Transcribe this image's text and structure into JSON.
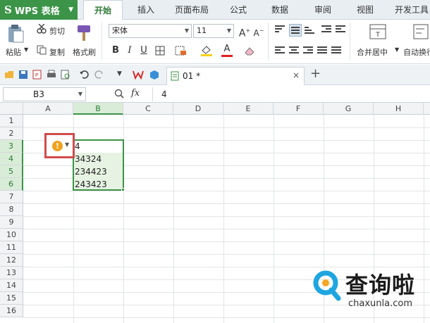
{
  "app": {
    "brand": "WPS 表格",
    "tabs": [
      {
        "label": "开始",
        "active": true
      },
      {
        "label": "插入",
        "active": false
      },
      {
        "label": "页面布局",
        "active": false
      },
      {
        "label": "公式",
        "active": false
      },
      {
        "label": "数据",
        "active": false
      },
      {
        "label": "审阅",
        "active": false
      },
      {
        "label": "视图",
        "active": false
      },
      {
        "label": "开发工具",
        "active": false
      }
    ]
  },
  "ribbon": {
    "paste_label": "粘贴",
    "cut_label": "剪切",
    "copy_label": "复制",
    "format_painter_label": "格式刷",
    "font_name": "宋体",
    "font_size": "11",
    "merge_label": "合并居中",
    "wrap_label": "自动换行"
  },
  "document": {
    "tab_name": "01 *",
    "close_glyph": "×",
    "new_tab_glyph": "+"
  },
  "formula_bar": {
    "name_box": "B3",
    "fx_label": "fx",
    "value": "4"
  },
  "grid": {
    "columns": [
      "A",
      "B",
      "C",
      "D",
      "E",
      "F",
      "G",
      "H"
    ],
    "selected_column": "B",
    "rows": [
      "1",
      "2",
      "3",
      "4",
      "5",
      "6",
      "7",
      "8",
      "9",
      "10",
      "11",
      "12",
      "13",
      "14",
      "15",
      "16"
    ],
    "selected_rows": [
      "3",
      "4",
      "5",
      "6"
    ],
    "cells": [
      {
        "ref": "B3",
        "value": "4"
      },
      {
        "ref": "B4",
        "value": "34324"
      },
      {
        "ref": "B5",
        "value": "234423"
      },
      {
        "ref": "B6",
        "value": "243423"
      }
    ]
  },
  "colors": {
    "brand_green": "#3b9447",
    "warning": "#f0a11b",
    "highlight_box": "#d24b4b"
  },
  "watermark": {
    "text_cn": "查询啦",
    "text_en": "chaxunla.com"
  }
}
